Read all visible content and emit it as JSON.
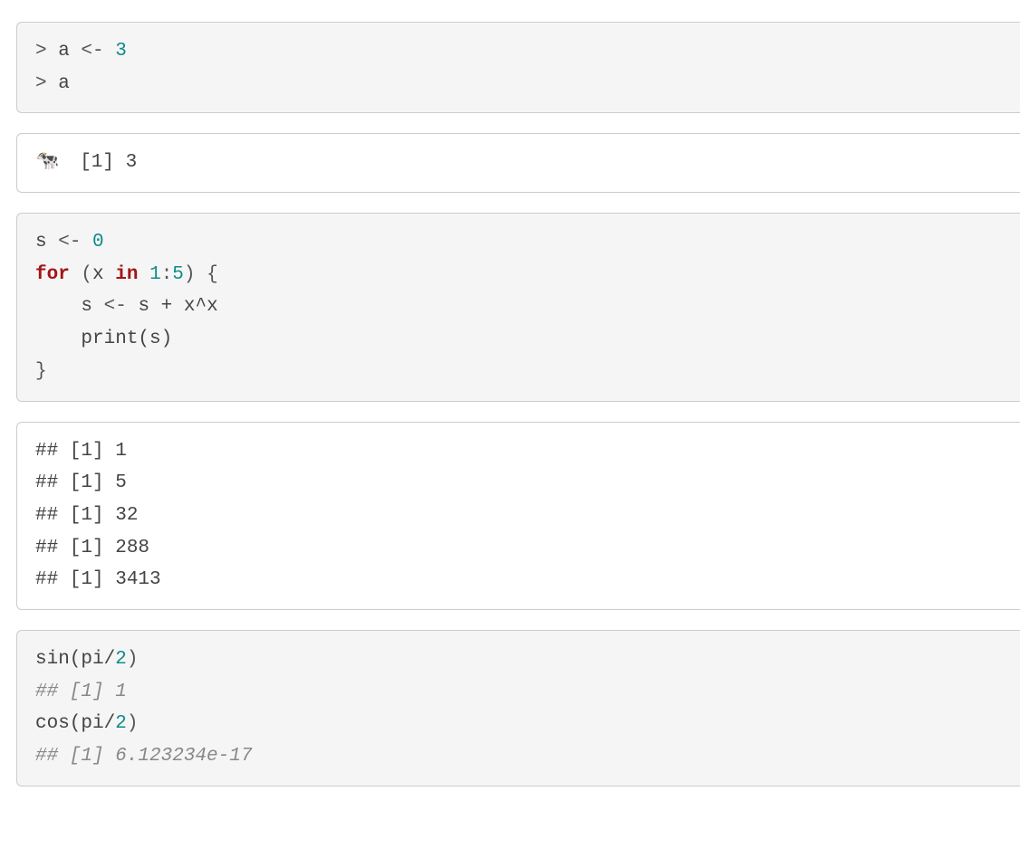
{
  "block1": {
    "line1": {
      "prompt": "> ",
      "var": "a",
      "op": " <- ",
      "val": "3"
    },
    "line2": {
      "prompt": "> ",
      "var": "a"
    }
  },
  "block2": {
    "emoji": "🐄",
    "text": "  [1] 3"
  },
  "block3": {
    "l1": {
      "var": "s",
      "op": " <- ",
      "val": "0"
    },
    "l2": {
      "kw_for": "for",
      "sp1": " (",
      "x": "x",
      "sp2": " ",
      "kw_in": "in",
      "sp3": " ",
      "one": "1",
      "colon": ":",
      "five": "5",
      "close": ") {"
    },
    "l3": {
      "indent": "    ",
      "lhs": "s",
      "op": " <- ",
      "expr": "s + x^x"
    },
    "l4": {
      "indent": "    ",
      "call": "print(s)"
    },
    "l5": {
      "brace": "}"
    }
  },
  "block4": {
    "l1": "## [1] 1",
    "l2": "## [1] 5",
    "l3": "## [1] 32",
    "l4": "## [1] 288",
    "l5": "## [1] 3413"
  },
  "block5": {
    "l1": {
      "fn": "sin(pi/",
      "num": "2",
      "close": ")"
    },
    "l2": {
      "comment": "## [1] 1"
    },
    "l3": {
      "fn": "cos(pi/",
      "num": "2",
      "close": ")"
    },
    "l4": {
      "comment": "## [1] 6.123234e-17"
    }
  }
}
